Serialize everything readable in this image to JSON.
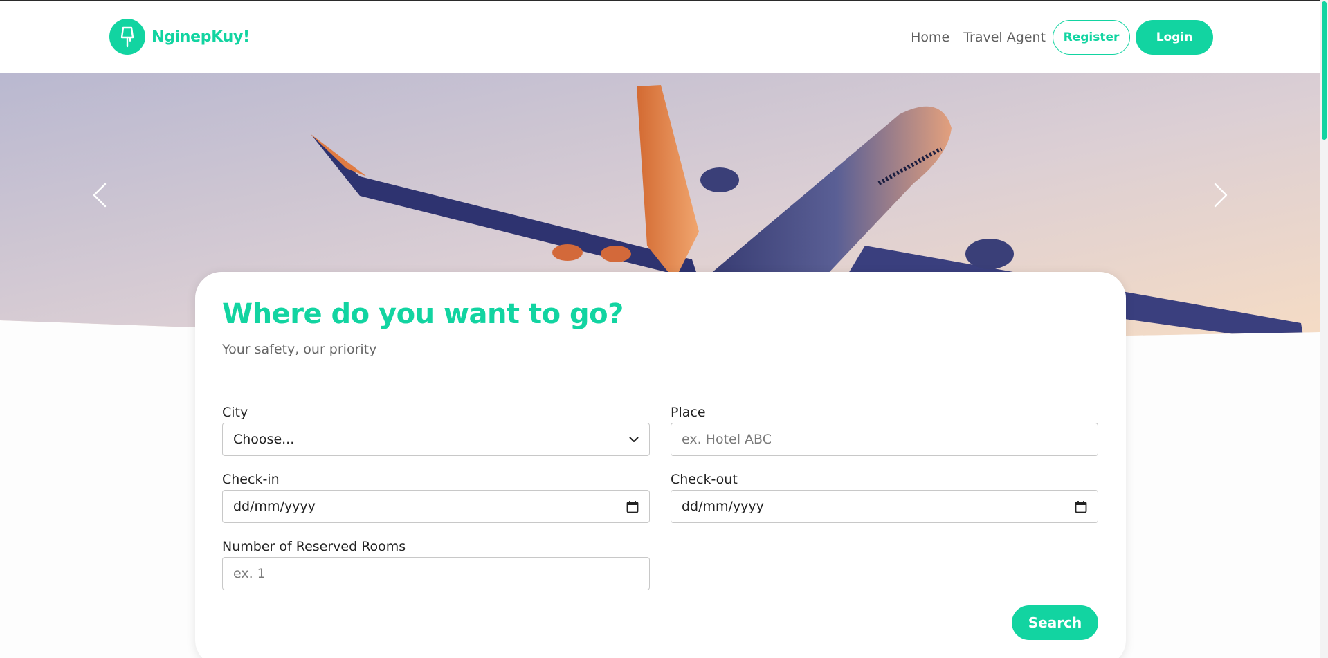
{
  "brand": {
    "name": "NginepKuy!",
    "logo_icon": "lamp-icon",
    "color": "#12d4a1"
  },
  "nav": {
    "home": "Home",
    "travel_agent": "Travel Agent",
    "register": "Register",
    "login": "Login"
  },
  "hero": {
    "image": "airplane-sunset-image",
    "prev_icon": "chevron-left-icon",
    "next_icon": "chevron-right-icon"
  },
  "search_card": {
    "title": "Where do you want to go?",
    "subtitle": "Your safety, our priority",
    "city": {
      "label": "City",
      "value": "Choose..."
    },
    "place": {
      "label": "Place",
      "placeholder": "ex. Hotel ABC"
    },
    "check_in": {
      "label": "Check-in",
      "value": "dd/mm/yyyy"
    },
    "check_out": {
      "label": "Check-out",
      "value": "dd/mm/yyyy"
    },
    "rooms": {
      "label": "Number of Reserved Rooms",
      "placeholder": "ex. 1"
    },
    "search_button": "Search"
  }
}
